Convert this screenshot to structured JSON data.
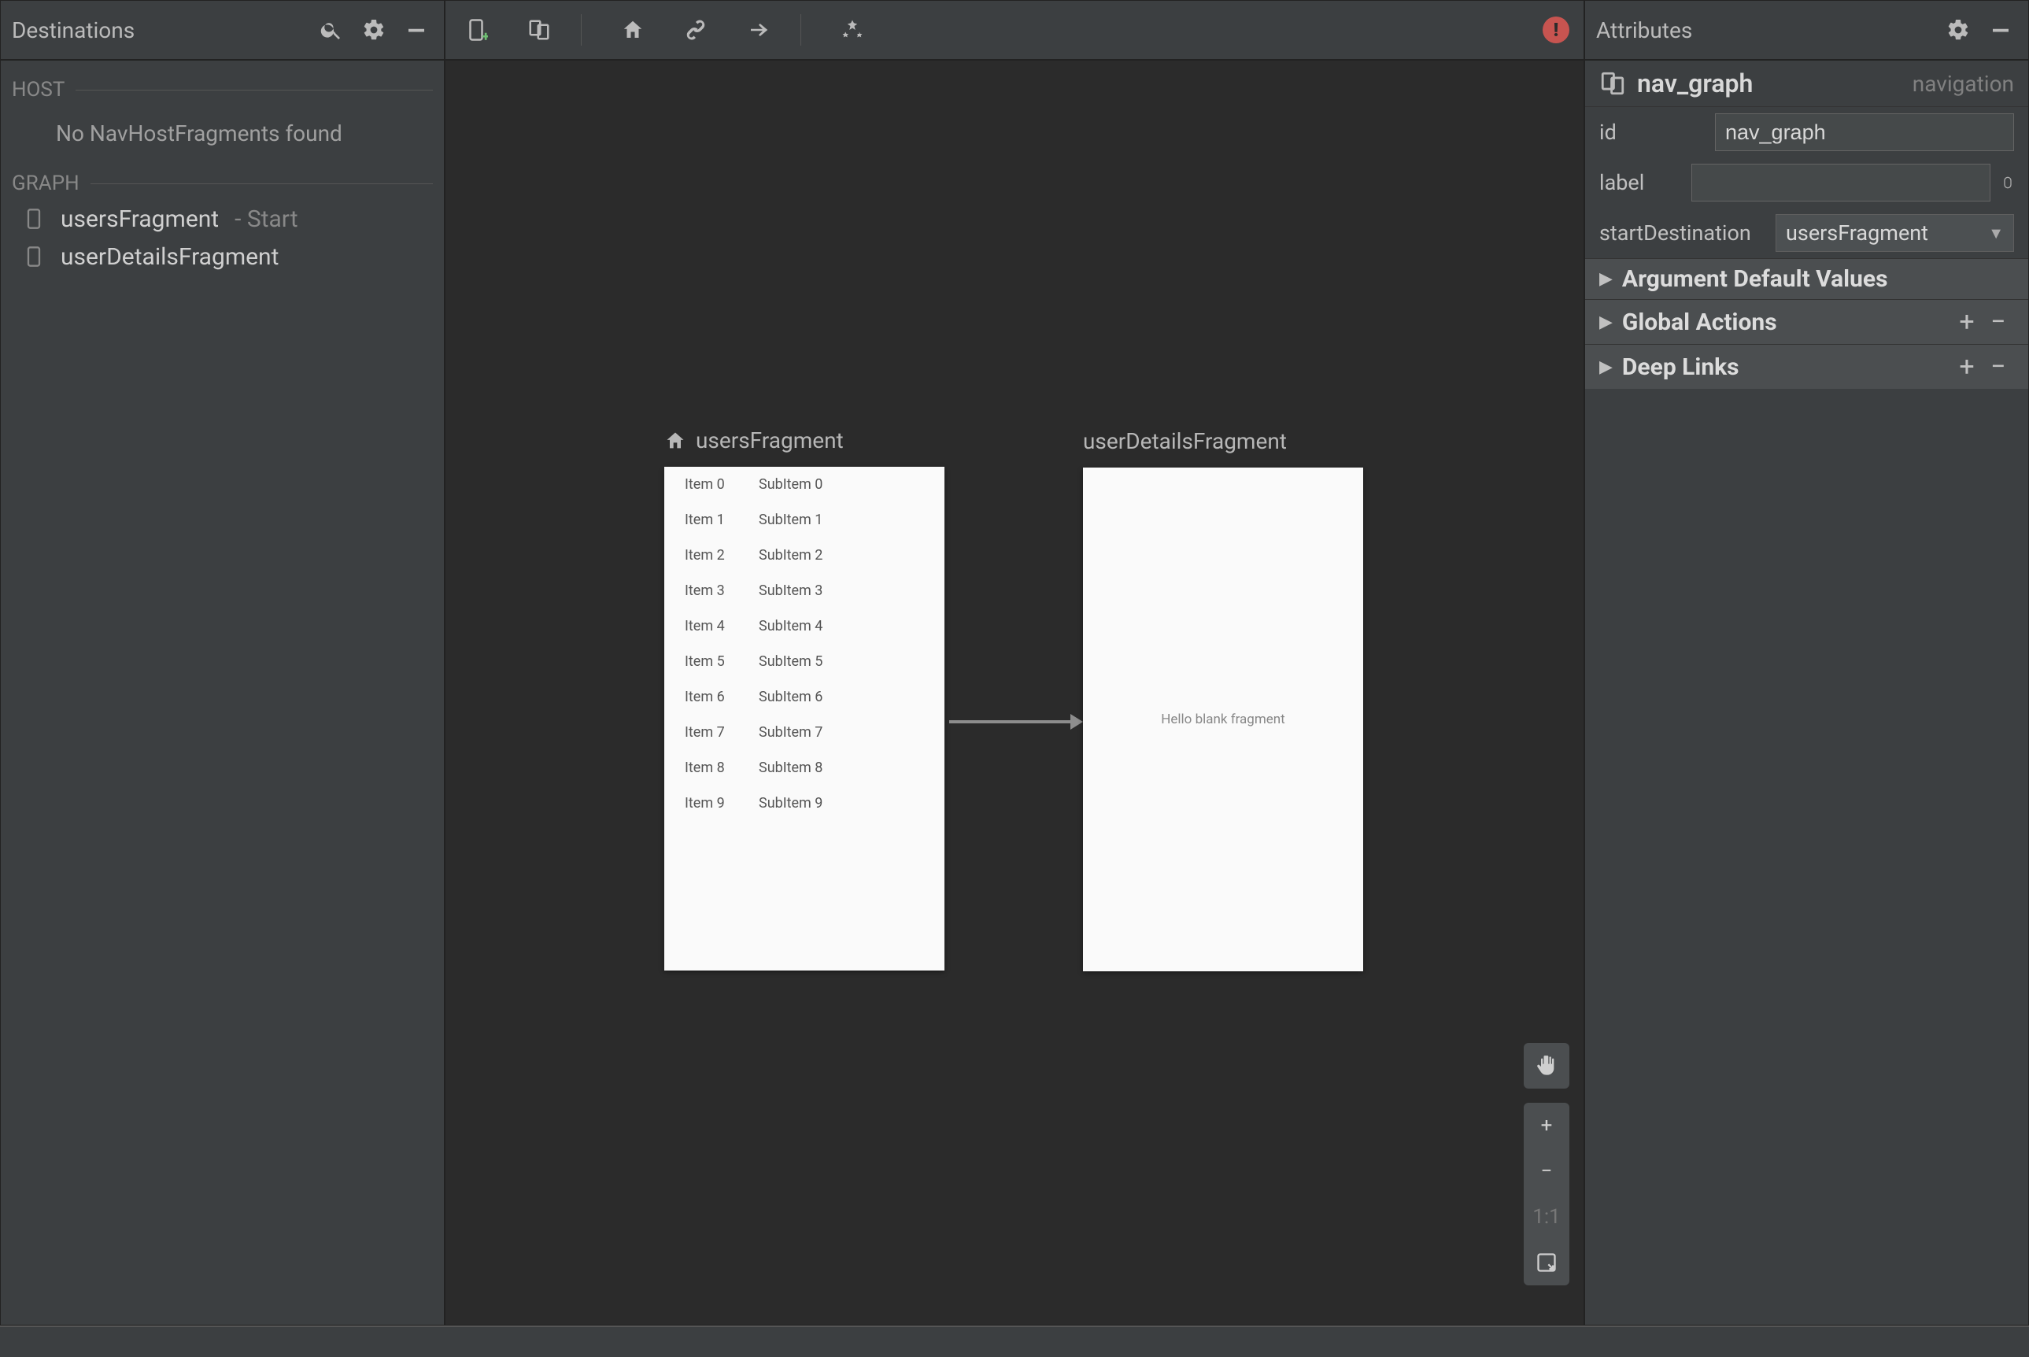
{
  "leftPanel": {
    "title": "Destinations",
    "host": {
      "label": "HOST",
      "empty": "No NavHostFragments found"
    },
    "graph": {
      "label": "GRAPH",
      "items": [
        {
          "name": "usersFragment",
          "suffix": " - Start"
        },
        {
          "name": "userDetailsFragment",
          "suffix": ""
        }
      ]
    }
  },
  "canvas": {
    "nodes": {
      "users": {
        "label": "usersFragment",
        "rows": [
          {
            "a": "Item 0",
            "b": "SubItem 0"
          },
          {
            "a": "Item 1",
            "b": "SubItem 1"
          },
          {
            "a": "Item 2",
            "b": "SubItem 2"
          },
          {
            "a": "Item 3",
            "b": "SubItem 3"
          },
          {
            "a": "Item 4",
            "b": "SubItem 4"
          },
          {
            "a": "Item 5",
            "b": "SubItem 5"
          },
          {
            "a": "Item 6",
            "b": "SubItem 6"
          },
          {
            "a": "Item 7",
            "b": "SubItem 7"
          },
          {
            "a": "Item 8",
            "b": "SubItem 8"
          },
          {
            "a": "Item 9",
            "b": "SubItem 9"
          }
        ]
      },
      "details": {
        "label": "userDetailsFragment",
        "placeholder": "Hello blank fragment"
      }
    },
    "tools": {
      "oneToOne": "1:1"
    }
  },
  "rightPanel": {
    "title": "Attributes",
    "graphName": "nav_graph",
    "graphType": "navigation",
    "fields": {
      "idLabel": "id",
      "idValue": "nav_graph",
      "labelLabel": "label",
      "labelValue": "",
      "startLabel": "startDestination",
      "startValue": "usersFragment"
    },
    "sections": {
      "argDefaults": "Argument Default Values",
      "globalActions": "Global Actions",
      "deepLinks": "Deep Links"
    }
  },
  "icons": {
    "plus": "+",
    "minus": "−",
    "warn": "!"
  }
}
